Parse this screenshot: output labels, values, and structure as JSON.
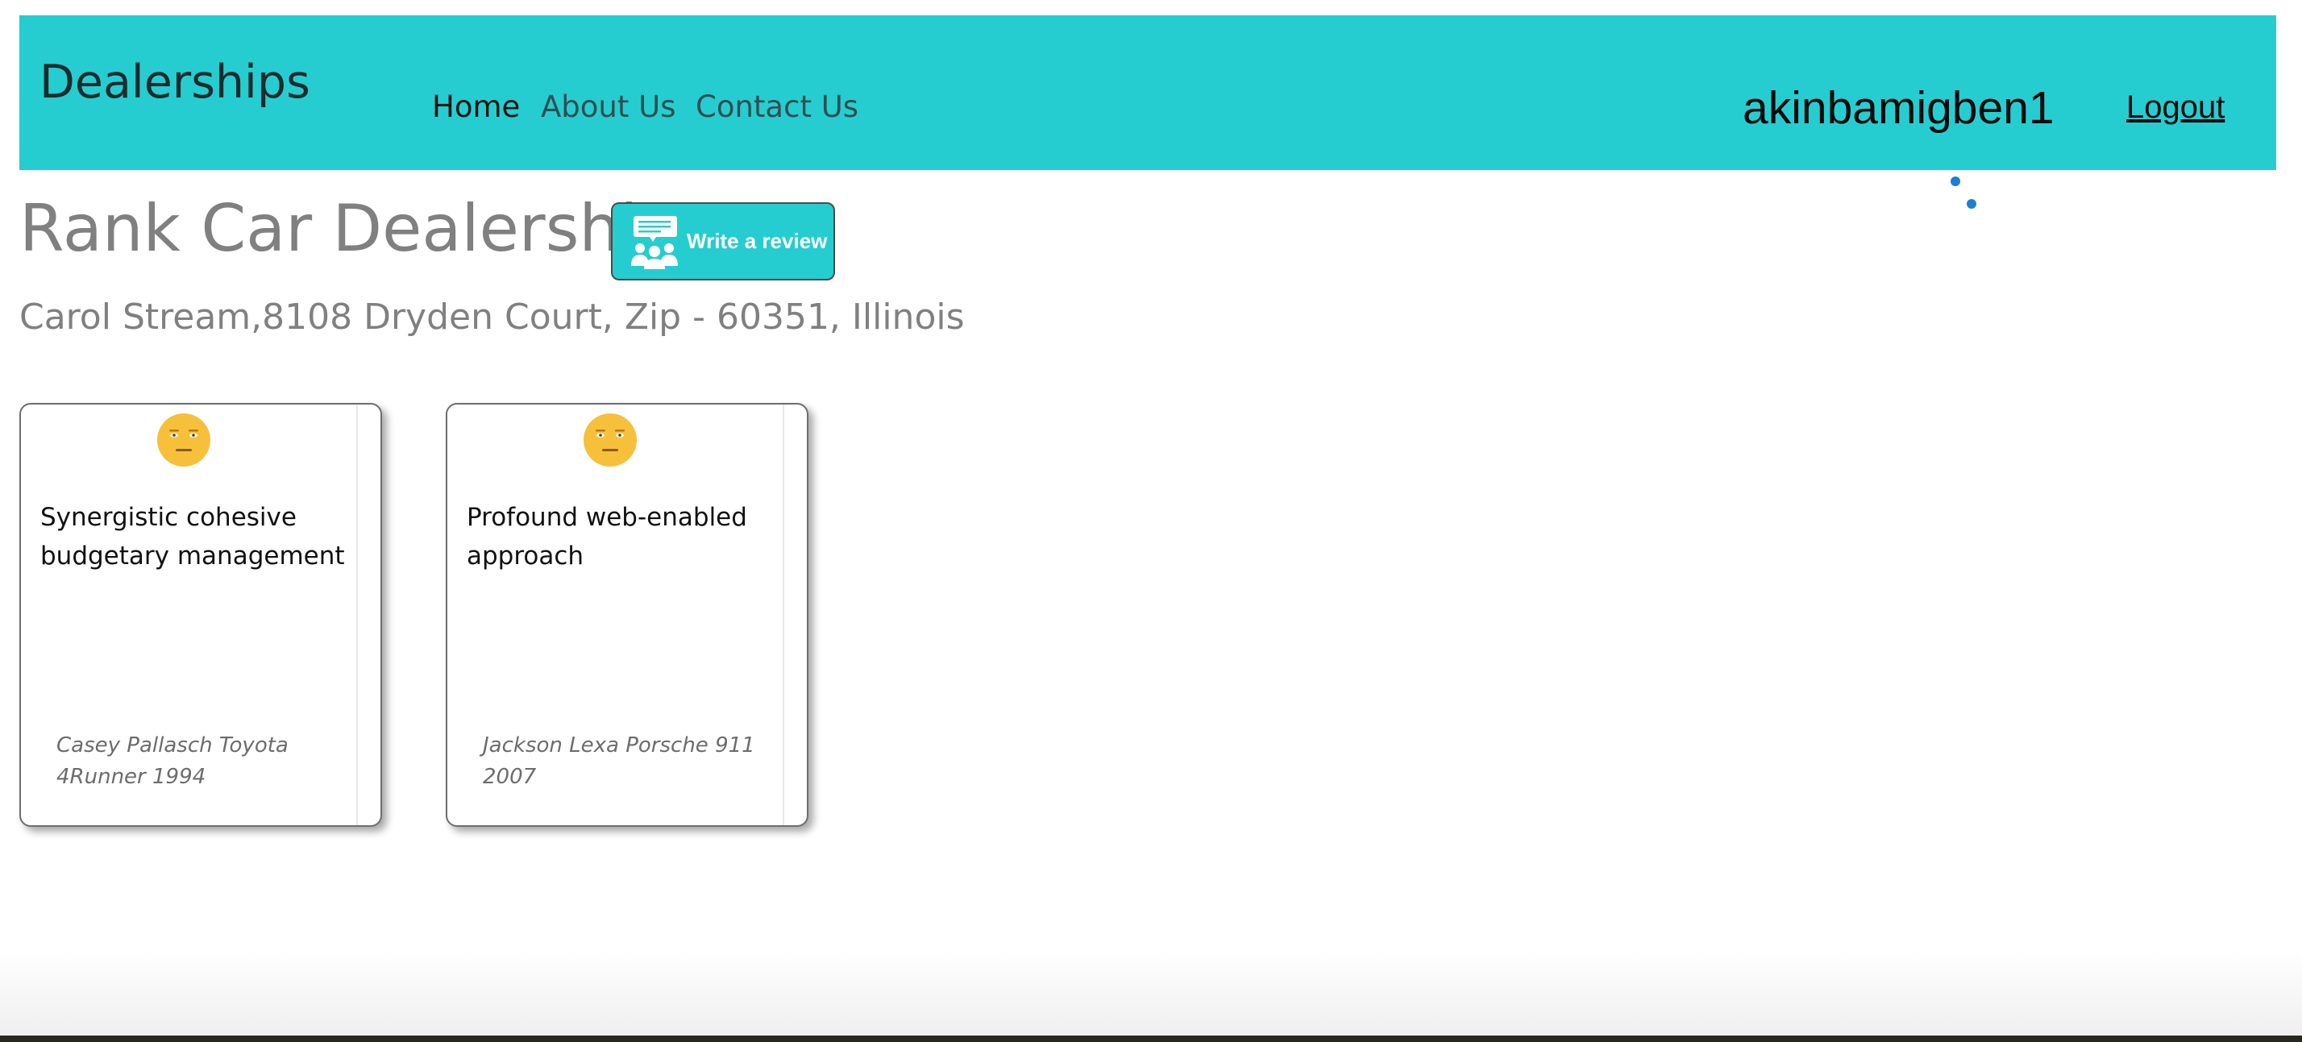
{
  "navbar": {
    "brand": "Dealerships",
    "links": [
      {
        "label": "Home",
        "active": true
      },
      {
        "label": "About Us",
        "active": false
      },
      {
        "label": "Contact Us",
        "active": false
      }
    ],
    "username": "akinbamigben1",
    "logout_label": "Logout"
  },
  "dealer": {
    "name": "Rank Car Dealership",
    "address": "Carol Stream,8108 Dryden Court, Zip - 60351, Illinois",
    "review_button_label": "Write a review",
    "review_button_icon": "review-chat-icon"
  },
  "reviews": [
    {
      "sentiment_icon": "neutral-face-icon",
      "text": "Synergistic cohesive budgetary management",
      "footer": "Casey Pallasch Toyota 4Runner 1994"
    },
    {
      "sentiment_icon": "neutral-face-icon",
      "text": "Profound web-enabled approach",
      "footer": "Jackson Lexa Porsche 911 2007"
    }
  ],
  "colors": {
    "navbar_bg": "#26cdd0",
    "heading_text": "#808080",
    "loader_dot": "#1a7fd6",
    "emoji_face": "#f6c03a"
  }
}
